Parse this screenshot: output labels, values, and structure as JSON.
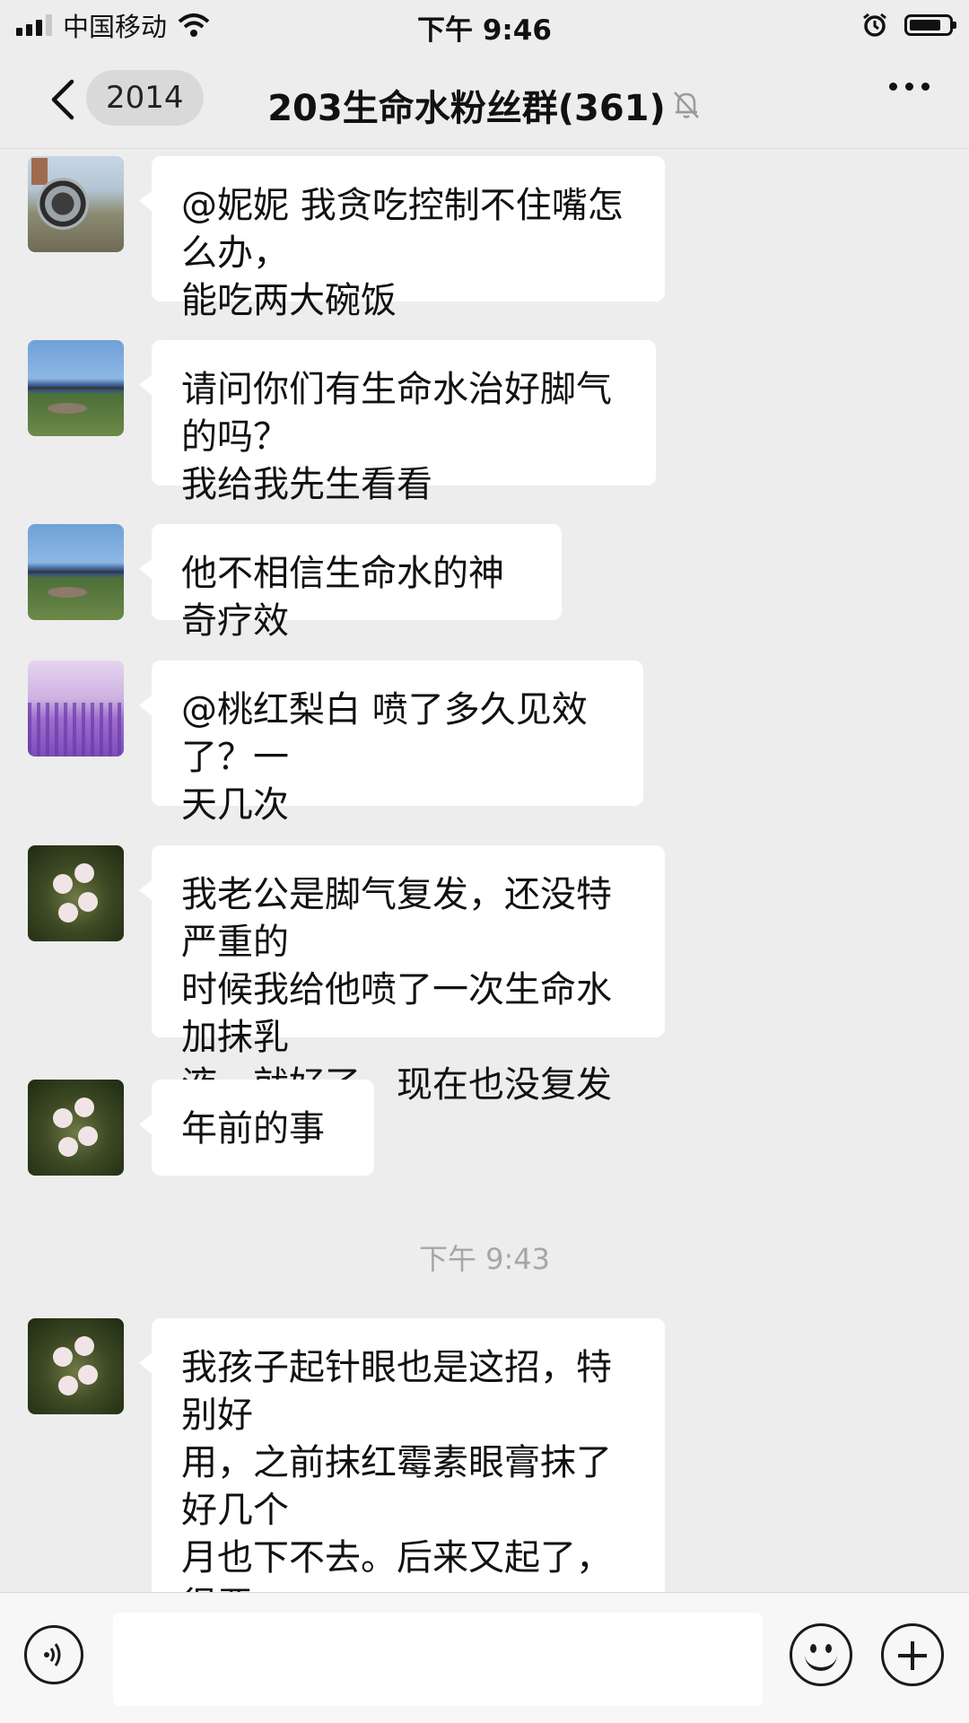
{
  "status_bar": {
    "carrier": "中国移动",
    "time": "下午 9:46"
  },
  "nav": {
    "back_badge": "2014",
    "title": "203生命水粉丝群(361)",
    "muted_icon": "bell-off-icon",
    "more_icon": "more-icon"
  },
  "messages": [
    {
      "avatar": "machine-photo",
      "text": "@妮妮 我贪吃控制不住嘴怎么办，\n能吃两大碗饭"
    },
    {
      "avatar": "seaside-photo",
      "text": "请问你们有生命水治好脚气的吗？\n我给我先生看看"
    },
    {
      "avatar": "seaside-photo",
      "text": "他不相信生命水的神奇疗效"
    },
    {
      "avatar": "lavender-photo",
      "text": "@桃红梨白 喷了多久见效了？一\n天几次"
    },
    {
      "avatar": "flower-photo",
      "text": "我老公是脚气复发，还没特严重的\n时候我给他喷了一次生命水加抹乳\n液，就好了，现在也没复发了"
    },
    {
      "avatar": "flower-photo",
      "text": "年前的事"
    },
    {
      "avatar": "flower-photo",
      "text": "我孩子起针眼也是这招，特别好\n用，之前抹红霉素眼膏抹了好几个\n月也下不去。后来又起了，很严\n重，我就喷的生命水和乳液，一周\n基本就剩一小点了"
    }
  ],
  "timestamp": "下午 9:43",
  "input_bar": {
    "voice_icon": "voice-icon",
    "emoji_icon": "emoji-icon",
    "plus_icon": "plus-icon"
  }
}
